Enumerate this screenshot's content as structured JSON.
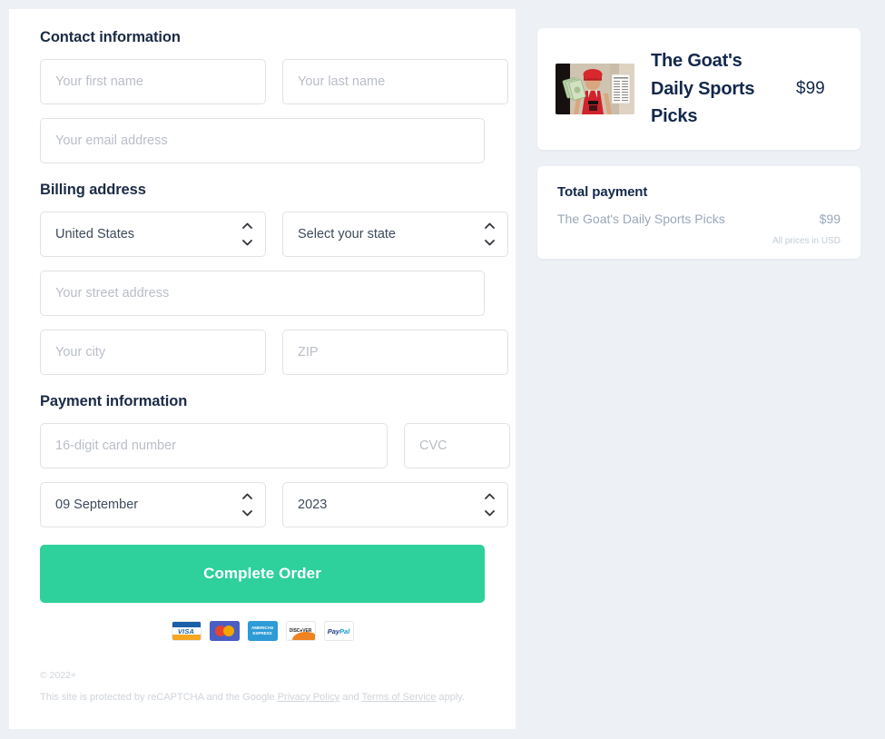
{
  "form": {
    "contact_heading": "Contact information",
    "first_name_placeholder": "Your first name",
    "last_name_placeholder": "Your last name",
    "email_placeholder": "Your email address",
    "billing_heading": "Billing address",
    "country_value": "United States",
    "state_value": "Select your state",
    "street_placeholder": "Your street address",
    "city_placeholder": "Your city",
    "zip_placeholder": "ZIP",
    "payment_heading": "Payment information",
    "card_number_placeholder": "16-digit card number",
    "cvc_placeholder": "CVC",
    "exp_month_value": "09 September",
    "exp_year_value": "2023",
    "submit_label": "Complete Order"
  },
  "payment_methods": [
    {
      "name": "visa-card-icon",
      "label": "VISA"
    },
    {
      "name": "mastercard-card-icon",
      "label": ""
    },
    {
      "name": "amex-card-icon",
      "label_line1": "AMERICAN",
      "label_line2": "EXPRESS"
    },
    {
      "name": "discover-card-icon",
      "label": "DISC●VER"
    },
    {
      "name": "paypal-card-icon",
      "label_a": "Pay",
      "label_b": "Pal"
    }
  ],
  "footer": {
    "copyright": "© 2022+",
    "recaptcha_prefix": "This site is protected by reCAPTCHA and the Google ",
    "privacy_link": "Privacy Policy",
    "recaptcha_mid": " and ",
    "terms_link": "Terms of Service",
    "recaptcha_suffix": " apply."
  },
  "summary": {
    "product_title": "The Goat's Daily Sports Picks",
    "product_price": "$99",
    "total_heading": "Total payment",
    "line_item_label": "The Goat's Daily Sports Picks",
    "line_item_price": "$99",
    "currency_note": "All prices in USD"
  },
  "colors": {
    "accent": "#2ed09b",
    "heading": "#13284b",
    "muted": "#b9bec7",
    "page_bg": "#edf1f5"
  }
}
